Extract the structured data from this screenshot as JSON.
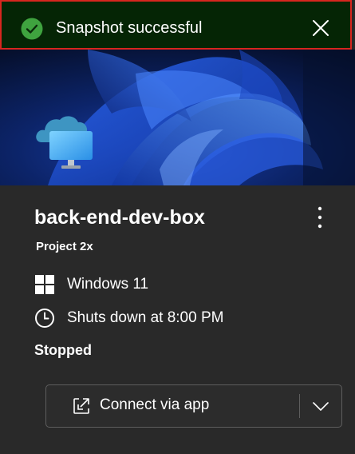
{
  "toast": {
    "message": "Snapshot successful",
    "status_icon": "check-circle-icon",
    "close_icon": "close-icon",
    "background": "#052505",
    "accent": "#3fa33f",
    "border": "#d8261f"
  },
  "card": {
    "title": "back-end-dev-box",
    "project": "Project 2x",
    "more_icon": "more-vertical-icon",
    "os": {
      "icon": "windows-icon",
      "label": "Windows 11"
    },
    "schedule": {
      "icon": "clock-icon",
      "label": "Shuts down at 8:00 PM"
    },
    "status": "Stopped",
    "connect": {
      "label": "Connect via app",
      "icon": "open-external-icon",
      "dropdown_icon": "chevron-down-icon"
    },
    "background": "#292929"
  }
}
